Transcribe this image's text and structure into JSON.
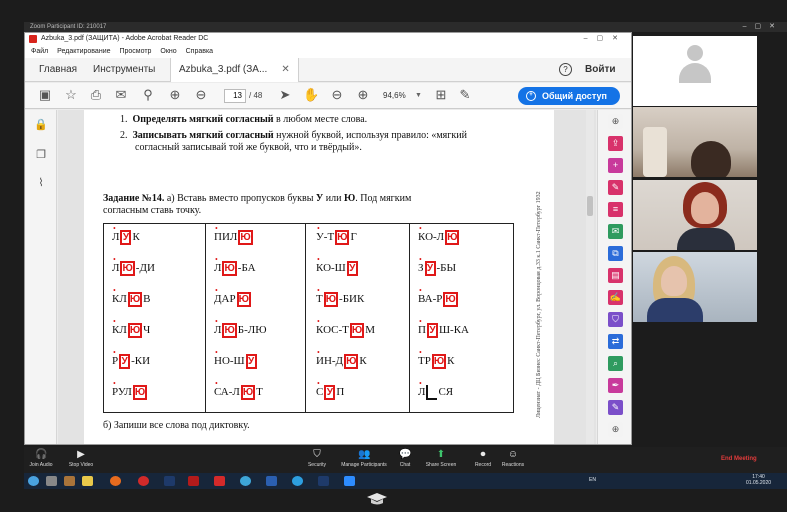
{
  "zoom": {
    "title": "Zoom Participant ID: 210017",
    "controls": [
      {
        "label": "Join Audio",
        "icon": "headphones-icon"
      },
      {
        "label": "Stop Video",
        "icon": "video-icon"
      },
      {
        "label": "Security",
        "icon": "shield-icon"
      },
      {
        "label": "Manage Participants",
        "icon": "participants-icon"
      },
      {
        "label": "Chat",
        "icon": "chat-icon"
      },
      {
        "label": "Share Screen",
        "icon": "share-screen-icon"
      },
      {
        "label": "Record",
        "icon": "record-icon"
      },
      {
        "label": "Reactions",
        "icon": "reactions-icon"
      }
    ],
    "end_meeting": "End Meeting"
  },
  "acrobat": {
    "title": "Azbuka_3.pdf (ЗАЩИТА) - Adobe Acrobat Reader DC",
    "menu": [
      "Файл",
      "Редактирование",
      "Просмотр",
      "Окно",
      "Справка"
    ],
    "tabs": {
      "home": "Главная",
      "tools": "Инструменты",
      "file": "Azbuka_3.pdf (ЗА..."
    },
    "help": "?",
    "login": "Войти",
    "page_current": "13",
    "page_total": "/ 48",
    "zoom_level": "94,6%",
    "share": "Общий доступ"
  },
  "document": {
    "rules": [
      {
        "num": "1.",
        "bold": "Определять мягкий согласный",
        "rest": " в любом месте слова."
      },
      {
        "num": "2.",
        "bold": "Записывать мягкий согласный",
        "rest": " нужной буквой, используя правило: «мягкий",
        "line2": "согласный записывай той же буквой, что и твёрдый»."
      }
    ],
    "task_bold": "Задание №14.",
    "task_text": " а) Вставь вместо пропусков буквы ",
    "task_u": "У",
    "task_or": " или ",
    "task_yu": "Ю",
    "task_text2": ". Под мягким",
    "task_line2": "согласным ставь точку.",
    "columns": [
      [
        {
          "pre": "Л",
          "fill": "У",
          "post": "К"
        },
        {
          "pre": "Л",
          "fill": "Ю",
          "post": "-ДИ"
        },
        {
          "pre": "КЛ",
          "fill": "Ю",
          "post": "В"
        },
        {
          "pre": "КЛ",
          "fill": "Ю",
          "post": "Ч"
        },
        {
          "pre": "Р",
          "fill": "У",
          "post": "-КИ"
        },
        {
          "pre": "РУЛ",
          "fill": "Ю",
          "post": ""
        }
      ],
      [
        {
          "pre": "ПИЛ",
          "fill": "Ю",
          "post": ""
        },
        {
          "pre": "Л",
          "fill": "Ю",
          "post": "-БА"
        },
        {
          "pre": "ДАР",
          "fill": "Ю",
          "post": ""
        },
        {
          "pre": "Л",
          "fill": "Ю",
          "post": "Б-ЛЮ"
        },
        {
          "pre": "НО-Ш",
          "fill": "У",
          "post": ""
        },
        {
          "pre": "СА-Л",
          "fill": "Ю",
          "post": "Т"
        }
      ],
      [
        {
          "pre": "У-Т",
          "fill": "Ю",
          "post": "Г"
        },
        {
          "pre": "КО-Ш",
          "fill": "У",
          "post": ""
        },
        {
          "pre": "Т",
          "fill": "Ю",
          "post": "-БИК"
        },
        {
          "pre": "КОС-Т",
          "fill": "Ю",
          "post": "М"
        },
        {
          "pre": "ИН-Д",
          "fill": "Ю",
          "post": "К"
        },
        {
          "pre": "С",
          "fill": "У",
          "post": "П"
        }
      ],
      [
        {
          "pre": "КО-Л",
          "fill": "Ю",
          "post": ""
        },
        {
          "pre": "З",
          "fill": "У",
          "post": "-БЫ"
        },
        {
          "pre": "ВА-Р",
          "fill": "Ю",
          "post": ""
        },
        {
          "pre": "П",
          "fill": "У",
          "post": "Ш-КА"
        },
        {
          "pre": "ТР",
          "fill": "Ю",
          "post": "К"
        },
        {
          "pre": "Л",
          "fill": "",
          "post": "СЯ"
        }
      ]
    ],
    "task_b": "б) Запиши все слова под диктовку.",
    "side_text": "Лицензиат - ДЦ Бизнес Санкт-Петербург, ул. Воронцовая д.33 к.1 Санкт-Петербург 1932"
  },
  "taskbar": {
    "lang": "EN",
    "time": "17:40",
    "date": "01.05.2020"
  },
  "colors": {
    "mark_red": "#e01818",
    "share_blue": "#1473e6",
    "end_red": "#e23b3b"
  }
}
